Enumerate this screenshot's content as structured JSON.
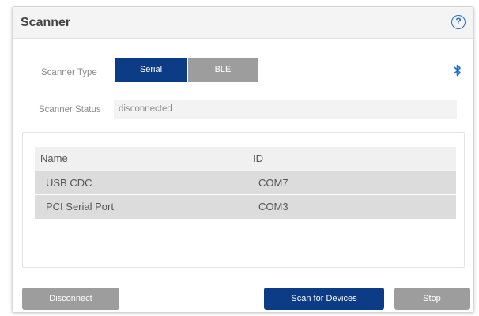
{
  "header": {
    "title": "Scanner",
    "help_icon": "question-circle-icon",
    "help_glyph": "?"
  },
  "scanner_type": {
    "label": "Scanner Type",
    "options": [
      "Serial",
      "BLE"
    ],
    "selected": "Serial",
    "status_icon": "bluetooth-icon"
  },
  "scanner_status": {
    "label": "Scanner Status",
    "value": "disconnected"
  },
  "devices": {
    "columns": [
      "Name",
      "ID"
    ],
    "rows": [
      {
        "name": "USB CDC",
        "id": "COM7"
      },
      {
        "name": "PCI Serial Port",
        "id": "COM3"
      }
    ]
  },
  "buttons": {
    "disconnect": "Disconnect",
    "scan": "Scan for Devices",
    "stop": "Stop"
  },
  "colors": {
    "primary": "#0d3c86",
    "inactive": "#9d9d9d",
    "accent_icon": "#1f6fd1"
  }
}
